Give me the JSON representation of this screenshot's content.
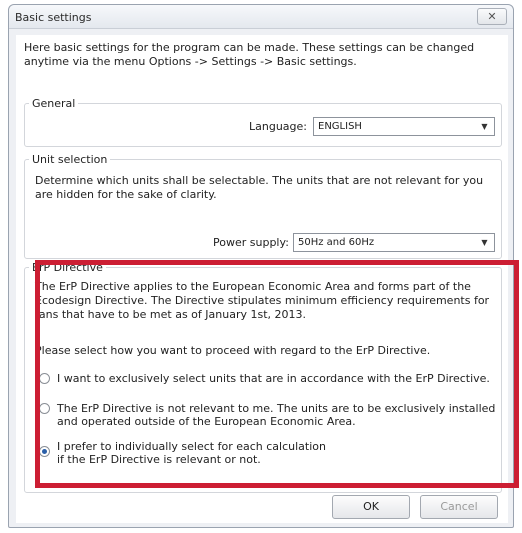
{
  "window": {
    "title": "Basic settings",
    "close_glyph": "✕"
  },
  "intro_text": "Here basic settings for the program can be made. These settings can be changed anytime via the menu Options -> Settings -> Basic settings.",
  "general": {
    "legend": "General",
    "language_label": "Language:",
    "language_value": "ENGLISH"
  },
  "unit_selection": {
    "legend": "Unit selection",
    "description": "Determine which units shall be selectable. The units that are not relevant for you are hidden for the sake of clarity.",
    "power_supply_label": "Power supply:",
    "power_supply_value": "50Hz and 60Hz"
  },
  "erp": {
    "legend": "ErP Directive",
    "description": "The ErP Directive applies to the European Economic Area and forms part of the Ecodesign Directive. The Directive stipulates minimum efficiency requirements for fans that have to be met as of January 1st, 2013.",
    "prompt": "Please select how you want to proceed with regard to the ErP Directive.",
    "options": [
      {
        "line1": "I want to exclusively select units that are in accordance with the ErP Directive.",
        "line2": "",
        "checked": false
      },
      {
        "line1": "The ErP Directive is not relevant to me. The units are to be exclusively installed",
        "line2": "and operated outside of the European Economic Area.",
        "checked": false
      },
      {
        "line1": "I prefer to individually select for each calculation",
        "line2": "if the ErP Directive is relevant or not.",
        "checked": true
      }
    ]
  },
  "buttons": {
    "ok": "OK",
    "cancel": "Cancel"
  },
  "icons": {
    "dropdown": "chevron-down-icon",
    "close": "close-icon"
  },
  "colors": {
    "highlight": "#cc1e33",
    "radio_dot": "#2a5fa8"
  }
}
